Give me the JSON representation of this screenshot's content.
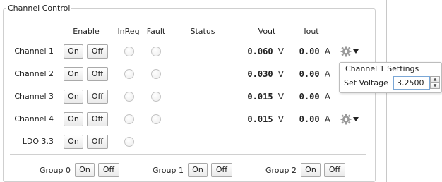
{
  "panel": {
    "title": "Channel Control"
  },
  "headers": {
    "enable": "Enable",
    "inreg": "InReg",
    "fault": "Fault",
    "status": "Status",
    "vout": "Vout",
    "iout": "Iout"
  },
  "buttons": {
    "on": "On",
    "off": "Off"
  },
  "channels": [
    {
      "label": "Channel 1",
      "vout": "0.060",
      "vout_unit": "V",
      "iout": "0.00",
      "iout_unit": "A"
    },
    {
      "label": "Channel 2",
      "vout": "0.030",
      "vout_unit": "V",
      "iout": "0.00",
      "iout_unit": "A"
    },
    {
      "label": "Channel 3",
      "vout": "0.015",
      "vout_unit": "V",
      "iout": "0.00",
      "iout_unit": "A"
    },
    {
      "label": "Channel 4",
      "vout": "0.015",
      "vout_unit": "V",
      "iout": "0.00",
      "iout_unit": "A"
    }
  ],
  "ldo": {
    "label": "LDO 3.3"
  },
  "groups": [
    {
      "label": "Group 0"
    },
    {
      "label": "Group 1"
    },
    {
      "label": "Group 2"
    }
  ],
  "popup": {
    "title": "Channel 1 Settings",
    "set_voltage_label": "Set Voltage",
    "set_voltage_value": "3.2500"
  },
  "icons": {
    "gear": "gear-icon",
    "dropdown": "dropdown-arrow-icon",
    "spin_up": "spin-up-icon",
    "spin_down": "spin-down-icon"
  },
  "colors": {
    "border": "#cfcfcf",
    "focus_border": "#7aa7d6",
    "led_off": "#ececec"
  }
}
